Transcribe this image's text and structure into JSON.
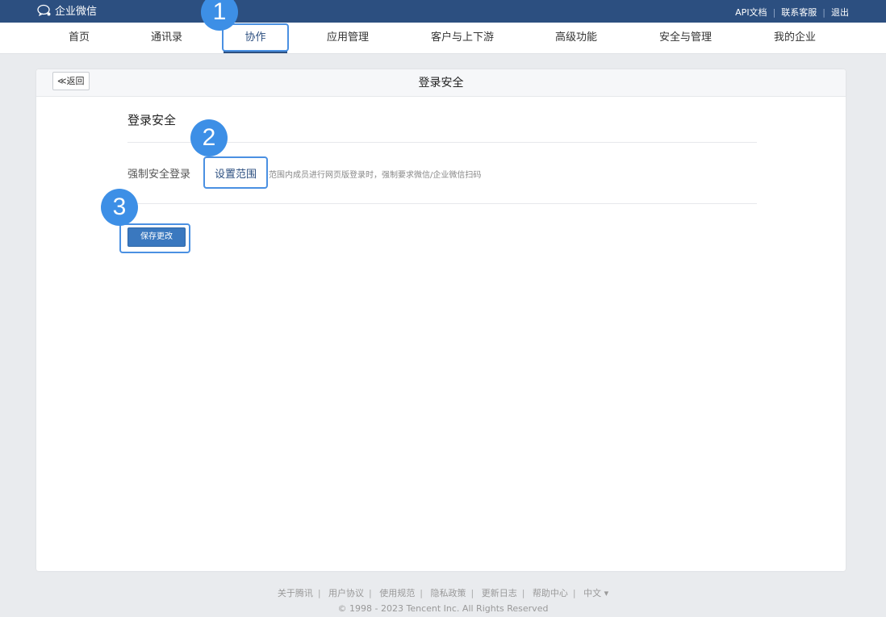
{
  "app": {
    "logo_text": "企业微信"
  },
  "toplinks": [
    "API文档",
    "联系客服",
    "退出"
  ],
  "nav": [
    "首页",
    "通讯录",
    "协作",
    "应用管理",
    "客户与上下游",
    "高级功能",
    "安全与管理",
    "我的企业"
  ],
  "active_nav": "协作",
  "card": {
    "back_label": "≪返回",
    "title": "登录安全",
    "section_title": "登录安全",
    "setting_label": "强制安全登录",
    "scope_link": "设置范围",
    "scope_description": "范围内成员进行网页版登录时，强制要求微信/企业微信扫码",
    "save_label": "保存更改"
  },
  "annotations": [
    "1",
    "2",
    "3"
  ],
  "footer": {
    "links": [
      "关于腾讯",
      "用户协议",
      "使用规范",
      "隐私政策",
      "更新日志",
      "帮助中心",
      "中文 ▾"
    ],
    "copyright": "© 1998 - 2023 Tencent Inc. All Rights Reserved"
  },
  "colors": {
    "topbar": "#2c4f80",
    "accent": "#2c4f80",
    "highlight": "#4a90e2",
    "badge": "#3d8fe6",
    "save_button": "#3a78bf"
  }
}
